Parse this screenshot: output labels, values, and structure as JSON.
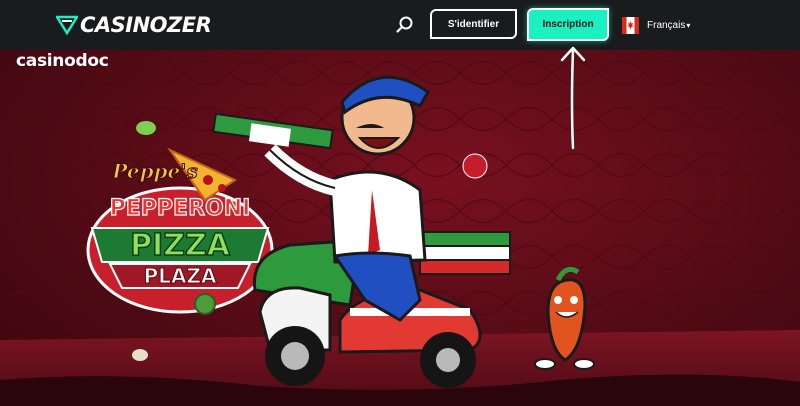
{
  "header": {
    "brand": "CASINOZER",
    "login_label": "S'identifier",
    "register_label": "Inscription",
    "language_label": "Français",
    "caret": "▾"
  },
  "hero": {
    "game_title_line1": "Peppe's",
    "game_title_line2": "PEPPERONI",
    "game_title_line3": "PIZZA",
    "game_title_line4": "PLAZA"
  },
  "watermark": "casinodoc",
  "colors": {
    "accent": "#1bf0c2",
    "topbar": "#1a1b1d",
    "hero_red": "#6b0e1c"
  },
  "icons": {
    "search": "search-icon",
    "flag": "canada-flag-icon",
    "logo": "casinozer-logo-icon"
  }
}
